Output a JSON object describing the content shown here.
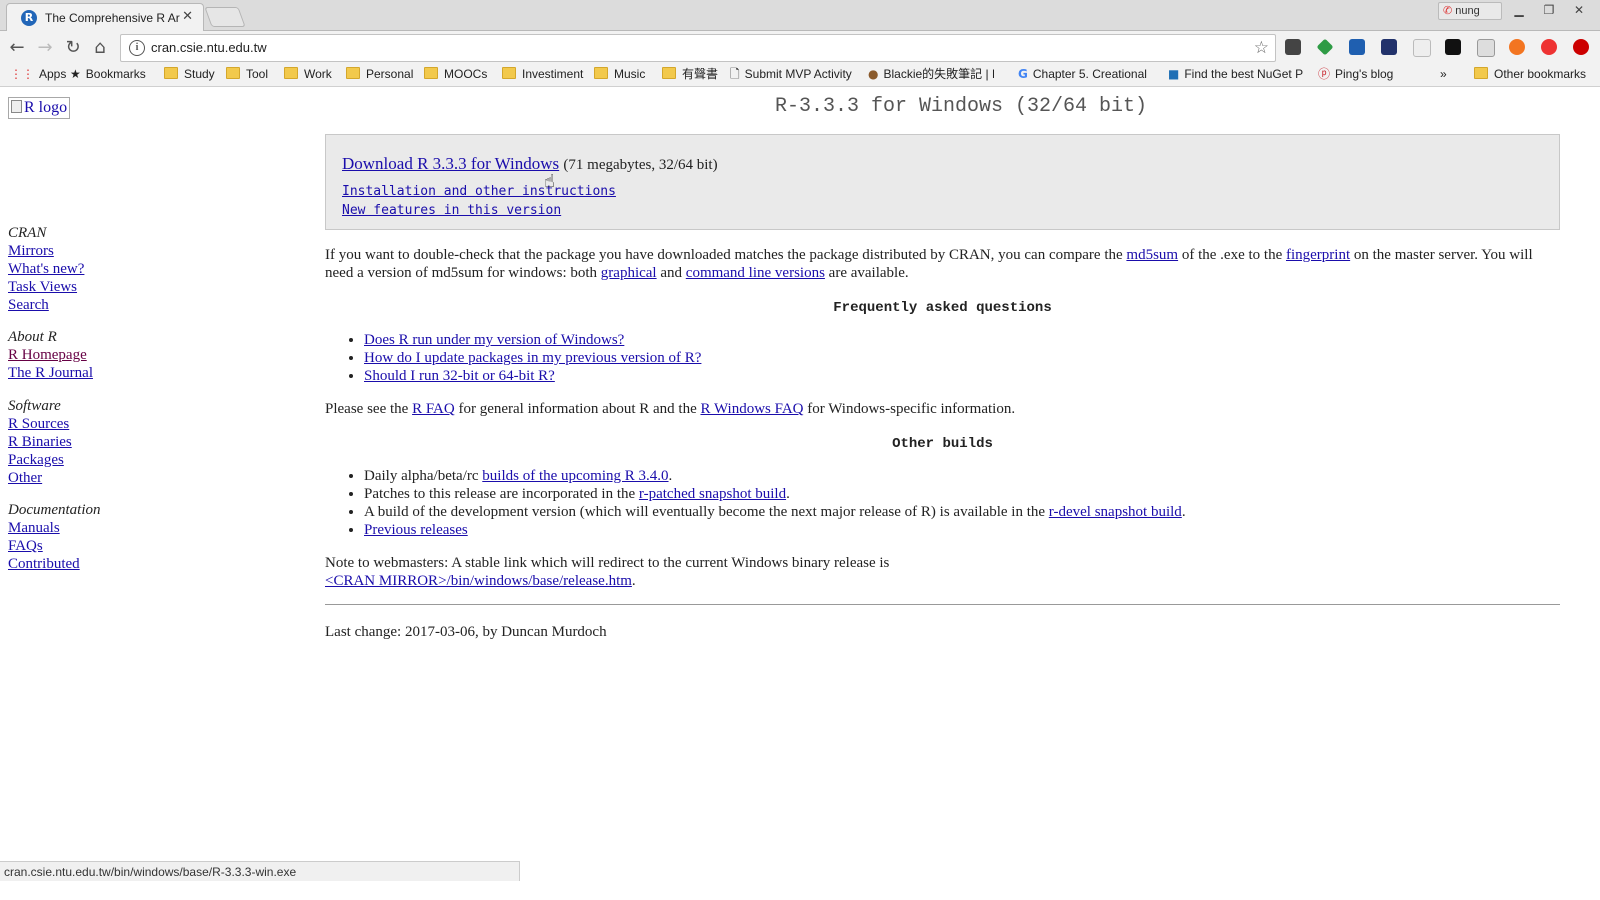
{
  "browser": {
    "tab_title": "The Comprehensive R Ar",
    "tab_favicon": "R",
    "tab_close": "✕",
    "profile_name": "nung",
    "url": "cran.csie.ntu.edu.tw",
    "status_url": "cran.csie.ntu.edu.tw/bin/windows/base/R-3.3.3-win.exe",
    "icons": [
      "back-icon",
      "forward-icon",
      "reload-icon",
      "home-icon",
      "info-icon",
      "star-icon",
      "pocket-icon",
      "extension-icon",
      "overflow-icon"
    ]
  },
  "bookmarks": {
    "items": [
      {
        "label": "Apps",
        "icon": "apps-grid-icon"
      },
      {
        "label": "Bookmarks",
        "icon": "star-icon"
      },
      {
        "label": "Study",
        "icon": "folder-icon"
      },
      {
        "label": "Tool",
        "icon": "folder-icon"
      },
      {
        "label": "Work",
        "icon": "folder-icon"
      },
      {
        "label": "Personal",
        "icon": "folder-icon"
      },
      {
        "label": "MOOCs",
        "icon": "folder-icon"
      },
      {
        "label": "Investiment",
        "icon": "folder-icon"
      },
      {
        "label": "Music",
        "icon": "folder-icon"
      },
      {
        "label": "有聲書",
        "icon": "folder-icon"
      },
      {
        "label": "Submit MVP Activity",
        "icon": "page-icon"
      },
      {
        "label": "Blackie的失敗筆記 | Bl",
        "icon": "avatar-icon"
      },
      {
        "label": "Chapter 5. Creational",
        "icon": "google-icon"
      },
      {
        "label": "Find the best NuGet P",
        "icon": "nuget-icon"
      },
      {
        "label": "Ping's blog",
        "icon": "pinterest-icon"
      }
    ],
    "overflow": "»",
    "other": "Other bookmarks"
  },
  "page": {
    "logo_alt": "R logo",
    "title": "R-3.3.3 for Windows (32/64 bit)",
    "download_link": "Download R 3.3.3 for Windows",
    "download_size": "(71 megabytes, 32/64 bit)",
    "install_link": "Installation and other instructions",
    "features_link": "New features in this version",
    "check_text_1": "If you want to double-check that the package you have downloaded matches the package distributed by CRAN, you can compare the ",
    "md5sum_link": "md5sum",
    "check_text_2": " of the .exe to the ",
    "fingerprint_link": "fingerprint",
    "check_text_3": " on the master server. You will need a version of md5sum for windows: both ",
    "graphical_link": "graphical",
    "check_text_4": " and ",
    "cmdline_link": "command line versions",
    "check_text_5": " are available.",
    "faq_heading": "Frequently asked questions",
    "faq_items": [
      "Does R run under my version of Windows?",
      "How do I update packages in my previous version of R?",
      "Should I run 32-bit or 64-bit R?"
    ],
    "please_text_1": "Please see the ",
    "rfaq_link": "R FAQ",
    "please_text_2": " for general information about R and the ",
    "rwinfaq_link": "R Windows FAQ",
    "please_text_3": " for Windows-specific information.",
    "other_heading": "Other builds",
    "builds_1_text": "Daily alpha/beta/rc ",
    "builds_1_link": "builds of the upcoming R 3.4.0",
    "builds_2_text": "Patches to this release are incorporated in the ",
    "builds_2_link": "r-patched snapshot build",
    "builds_3_text": "A build of the development version (which will eventually become the next major release of R) is available in the ",
    "builds_3_link": "r-devel snapshot build",
    "builds_4_link": "Previous releases",
    "note_text": "Note to webmasters: A stable link which will redirect to the current Windows binary release is",
    "note_link": "<CRAN MIRROR>/bin/windows/base/release.htm",
    "last_change": "Last change: 2017-03-06, by Duncan Murdoch"
  },
  "sidebar": {
    "cran_heading": "CRAN",
    "cran_links": [
      "Mirrors",
      "What's new?",
      "Task Views",
      "Search"
    ],
    "about_heading": "About R",
    "about_links": [
      "R Homepage",
      "The R Journal"
    ],
    "software_heading": "Software",
    "software_links": [
      "R Sources",
      "R Binaries",
      "Packages",
      "Other"
    ],
    "doc_heading": "Documentation",
    "doc_links": [
      "Manuals",
      "FAQs",
      "Contributed"
    ]
  },
  "colors": {
    "link": "#1a0dab",
    "visited": "#660044",
    "download_box": "#eaeaea"
  }
}
